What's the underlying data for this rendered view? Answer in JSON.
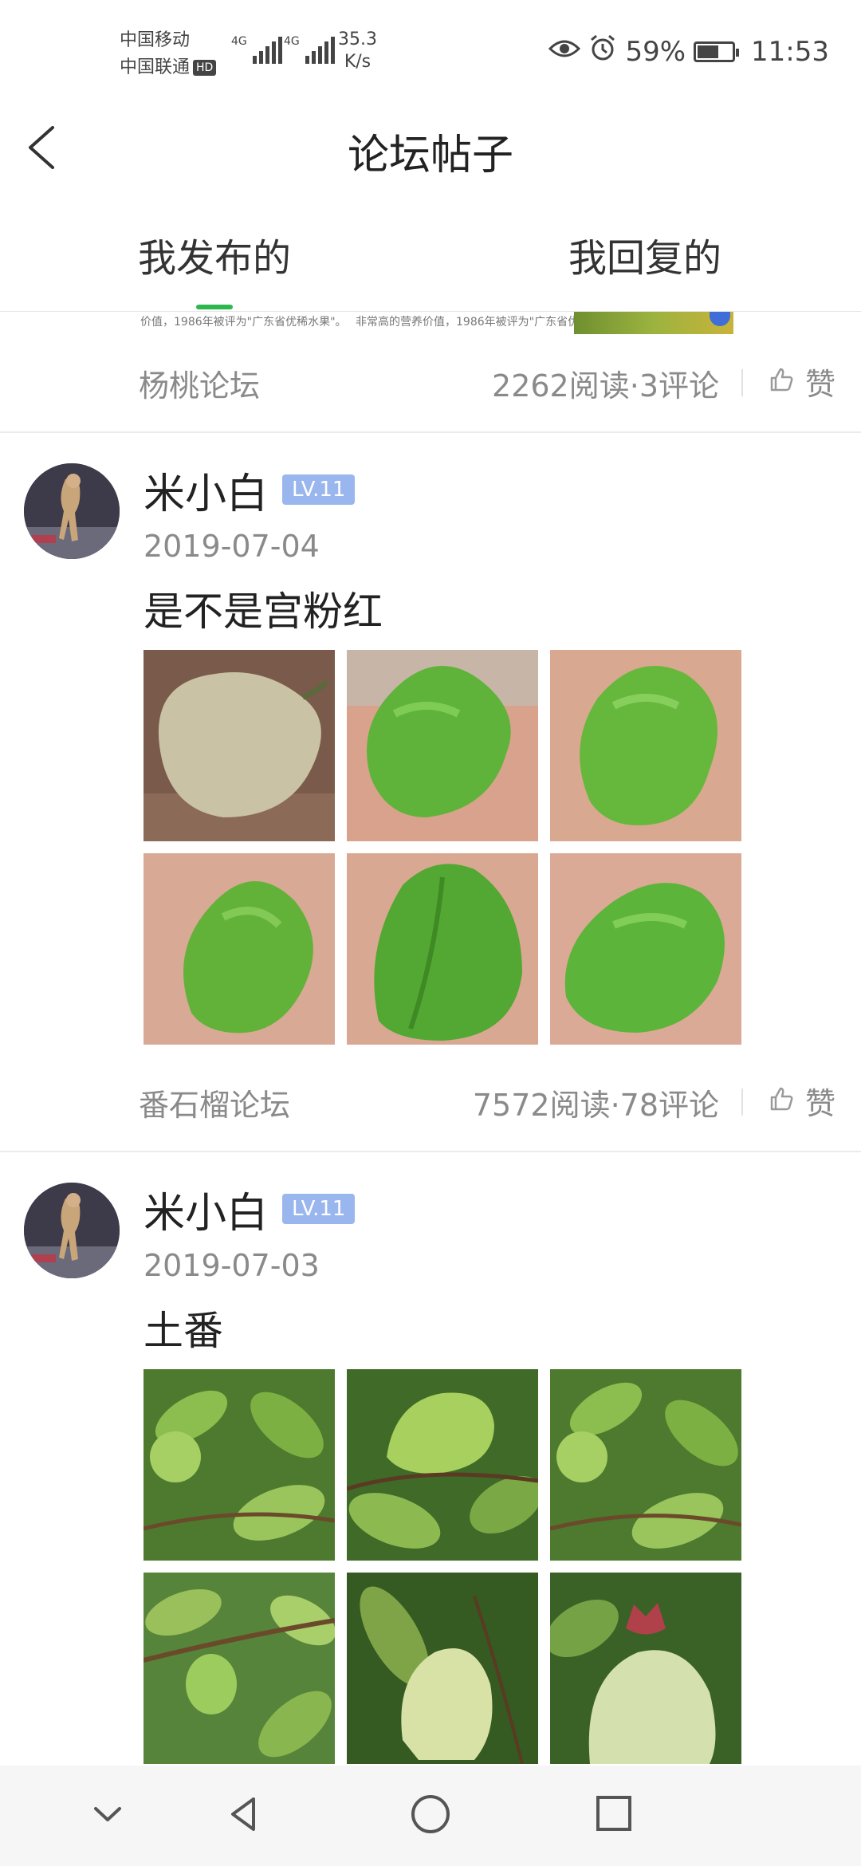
{
  "status_bar": {
    "carrier1": "中国移动",
    "carrier2": "中国联通",
    "hd": "HD",
    "net1": "4G",
    "net2": "4G",
    "speed_value": "35.3",
    "speed_unit": "K/s",
    "battery_percent": "59%",
    "battery_level": 0.59,
    "time": "11:53"
  },
  "header": {
    "title": "论坛帖子"
  },
  "tabs": [
    {
      "label": "我发布的",
      "active": true
    },
    {
      "label": "我回复的",
      "active": false
    }
  ],
  "previous_post": {
    "snippet_left": "价值，1986年被评为\"广东省优稀水果\"。",
    "snippet_right": "非常高的营养价值，1986年被评为\"广东省优",
    "forum": "杨桃论坛",
    "stats": "2262阅读·3评论",
    "like_label": "赞"
  },
  "posts": [
    {
      "username": "米小白",
      "level": "LV.11",
      "date": "2019-07-04",
      "text": "是不是宫粉红",
      "forum": "番石榴论坛",
      "stats": "7572阅读·78评论",
      "like_label": "赞"
    },
    {
      "username": "米小白",
      "level": "LV.11",
      "date": "2019-07-03",
      "text": "土番"
    }
  ],
  "icons": {
    "back": "back-arrow-icon",
    "eye": "eye-icon",
    "alarm": "alarm-icon",
    "battery": "battery-icon",
    "like": "thumbs-up-icon",
    "nav_hide": "chevron-down-icon",
    "nav_back": "triangle-back-icon",
    "nav_home": "circle-home-icon",
    "nav_recents": "square-recents-icon"
  },
  "colors": {
    "accent": "#2db84d",
    "level_badge": "#9ab6ee",
    "secondary_text": "#8a8a8a"
  }
}
